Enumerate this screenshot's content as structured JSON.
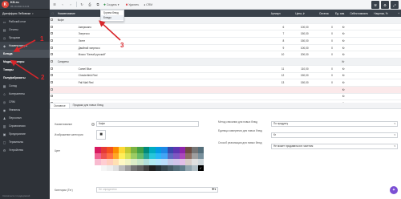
{
  "brand": {
    "name": "KS.ru",
    "subtitle": "05.10.2024 14:24"
  },
  "user": {
    "name": "Джеффрис Лебовски"
  },
  "sidebar": {
    "items": [
      {
        "label": "Рабочий стол",
        "icon": "desk-icon"
      },
      {
        "label": "Отчеты",
        "icon": "reports-icon"
      },
      {
        "label": "Продажи",
        "icon": "sales-icon"
      },
      {
        "label": "Номенклатура",
        "icon": "tag-icon"
      }
    ],
    "sub_items": [
      {
        "label": "Блюда"
      },
      {
        "label": "Модификаторы"
      },
      {
        "label": "Товары"
      },
      {
        "label": "Полуфабрикаты"
      }
    ],
    "lower_items": [
      {
        "label": "Склад",
        "icon": "warehouse-icon"
      },
      {
        "label": "Контрагенты",
        "icon": "contacts-icon"
      },
      {
        "label": "CRM",
        "icon": "crm-icon"
      },
      {
        "label": "Финансы",
        "icon": "finance-icon"
      },
      {
        "label": "Персонал",
        "icon": "staff-icon"
      },
      {
        "label": "Справочники",
        "icon": "book-icon"
      },
      {
        "label": "Предприятие",
        "icon": "building-icon"
      },
      {
        "label": "Терминалы",
        "icon": "terminal-icon"
      },
      {
        "label": "Устройства",
        "icon": "device-icon"
      }
    ],
    "support": "Связаться с поддержкой"
  },
  "toolbar": {
    "create": "Создать",
    "delete": "Удалить",
    "crm": "CRM"
  },
  "dropdown": {
    "items": [
      "Группа блюд",
      "Блюдо"
    ]
  },
  "table": {
    "headers": [
      "Наименование",
      "Артикул",
      "Цена, ₽",
      "Остаток",
      "Ед. изм.",
      "Себестоимость",
      "Наценка, %"
    ],
    "rows": [
      {
        "name": "Кофе",
        "group": true,
        "art": "",
        "price": "",
        "rest": "",
        "unit": ""
      },
      {
        "name": "Американо",
        "art": "6",
        "price": "100,00",
        "rest": "0",
        "unit": "Кг"
      },
      {
        "name": "Эспрессо",
        "art": "7",
        "price": "150,00",
        "rest": "0",
        "unit": "Кг"
      },
      {
        "name": "Латте",
        "art": "8",
        "price": "150,00",
        "rest": "0",
        "unit": "Кг"
      },
      {
        "name": "Двойной эспрессо",
        "art": "9",
        "price": "100,00",
        "rest": "0",
        "unit": "Кг"
      },
      {
        "name": "Мокко \"Белый русский\"",
        "art": "10",
        "price": "200,00",
        "rest": "0",
        "unit": "Кг"
      },
      {
        "name": "Сигареты",
        "group": true,
        "art": "",
        "price": "",
        "rest": "",
        "unit": "Кг"
      },
      {
        "name": "Camel Blue",
        "art": "11",
        "price": "110,00",
        "rest": "0",
        "unit": "Кг"
      },
      {
        "name": "Chesterfield Red",
        "art": "12",
        "price": "150,00",
        "rest": "0",
        "unit": "Кг"
      },
      {
        "name": "Pall Mall Red",
        "art": "13",
        "price": "150,00",
        "rest": "0",
        "unit": "Кг"
      },
      {
        "name": "",
        "art": "",
        "price": "",
        "rest": "",
        "unit": "Кг",
        "highlight": true
      },
      {
        "name": "",
        "art": "",
        "price": "",
        "rest": "",
        "unit": "Кг"
      },
      {
        "name": "",
        "art": "",
        "price": "",
        "rest": "",
        "unit": "Кг"
      }
    ]
  },
  "tabs": [
    "Основное",
    "Продажи для новых блюд"
  ],
  "form": {
    "name_label": "Наименование",
    "name_value": "Кофе",
    "image_label": "Изображение категории",
    "color_label": "Цвет",
    "categories_label": "Категории (Тег)",
    "categories_placeholder": "Не определено",
    "writeoff_label": "Метод списания для новых блюд",
    "writeoff_value": "По продукту",
    "unit_label": "Единица измерения для новых блюд",
    "unit_value": "Кг",
    "sale_label": "Способ реализации для новых блюд",
    "sale_value": "Не может продаваться в частном"
  },
  "annotations": [
    "1",
    "2",
    "3"
  ],
  "colors": {
    "sidebar": "#2e3238",
    "header": "#39414a",
    "accent": "#d8262b",
    "chat": "#7b4fd4",
    "palette_rows": [
      [
        "#d81b60",
        "#e53935",
        "#f4511e",
        "#fb8c00",
        "#fdd835",
        "#c0ca33",
        "#7cb342",
        "#43a047",
        "#00897b",
        "#00acc1",
        "#039be5",
        "#1e88e5",
        "#3949ab",
        "#5e35b1",
        "#8e24aa",
        "#6d4c41",
        "#757575",
        "#546e7a"
      ],
      [
        "#f06292",
        "#ef5350",
        "#ff7043",
        "#ffa726",
        "#ffee58",
        "#d4e157",
        "#9ccc65",
        "#66bb6a",
        "#26a69a",
        "#26c6da",
        "#29b6f6",
        "#42a5f5",
        "#5c6bc0",
        "#7e57c2",
        "#ab47bc",
        "#8d6e63",
        "#9e9e9e",
        "#78909c"
      ],
      [
        "#f8bbd0",
        "#ffcdd2",
        "#ffccbc",
        "#ffe0b2",
        "#fff9c4",
        "#f0f4c3",
        "#dcedc8",
        "#c8e6c9",
        "#b2dfdb",
        "#b2ebf2",
        "#b3e5fc",
        "#bbdefb",
        "#c5cae9",
        "#d1c4e9",
        "#e1bee7",
        "#d7ccc8",
        "#e0e0e0",
        "#cfd8dc"
      ],
      [
        "#ffffff",
        "#f5f5f5",
        "#eeeeee",
        "#e0e0e0",
        "#bdbdbd",
        "#9e9e9e",
        "#757575",
        "#616161",
        "#424242",
        "#212121",
        "#263238",
        "#37474f",
        "#455a64",
        "#546e7a",
        "#607d8b",
        "#90a4ae",
        "#b0bec5",
        "#000000"
      ]
    ]
  }
}
